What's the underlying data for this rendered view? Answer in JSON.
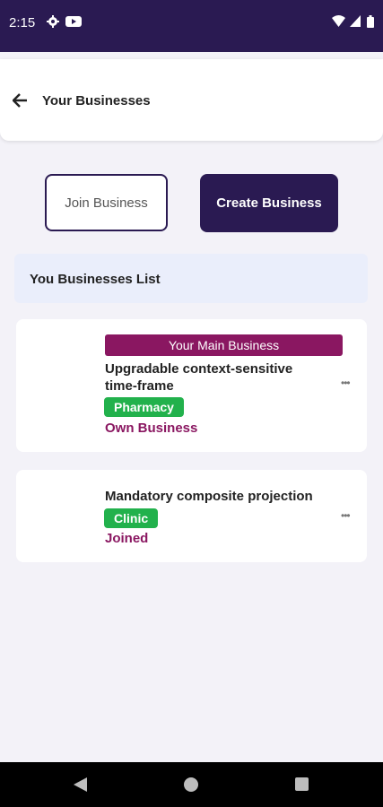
{
  "status_bar": {
    "time": "2:15",
    "icons": [
      "gear-icon",
      "youtube-icon",
      "wifi-icon",
      "signal-icon",
      "battery-icon"
    ]
  },
  "app_bar": {
    "title": "Your Businesses",
    "back_icon": "arrow-back-icon"
  },
  "actions": {
    "join_label": "Join Business",
    "create_label": "Create Business"
  },
  "list": {
    "header": "You Businesses List",
    "items": [
      {
        "badge": "Your Main Business",
        "name_line1": "Upgradable context-sensitive",
        "name_line2": "time-frame",
        "category": "Pharmacy",
        "status": "Own Business",
        "more_icon": "more-horizontal-icon"
      },
      {
        "name_line1": "Mandatory composite projection",
        "category": "Clinic",
        "status": "Joined",
        "more_icon": "more-horizontal-icon"
      }
    ]
  },
  "colors": {
    "primary": "#2a1a52",
    "accent": "#8a1761",
    "tag": "#22b14c",
    "header_bg": "#eaeefb",
    "page_bg": "#f3f2f8"
  },
  "nav_bar": {
    "icons": [
      "nav-back-icon",
      "nav-home-icon",
      "nav-recents-icon"
    ]
  }
}
